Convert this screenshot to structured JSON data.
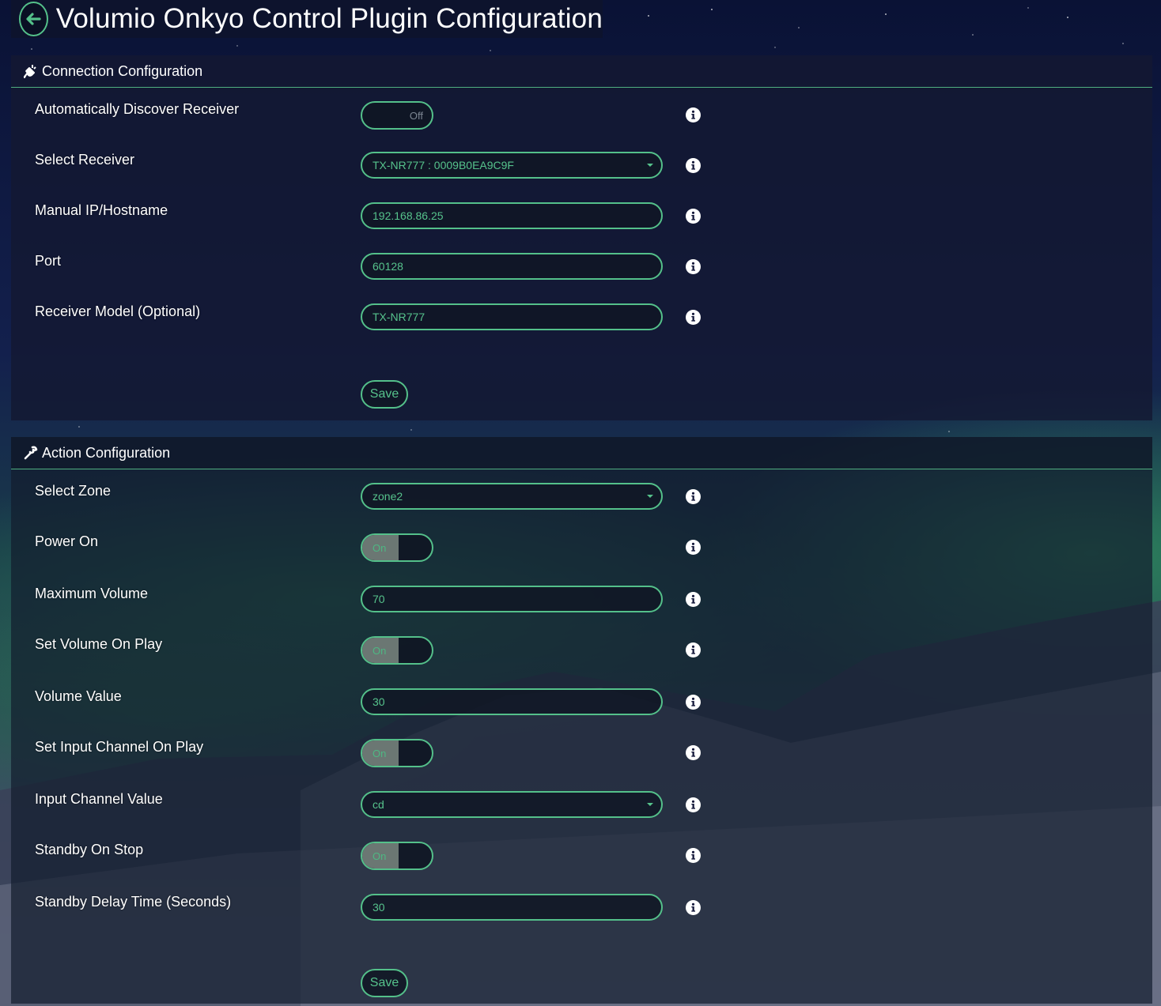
{
  "header": {
    "title": "Volumio Onkyo Control Plugin Configuration",
    "back_icon": "arrow-left-icon"
  },
  "theme": {
    "accent": "#54c08a",
    "panel_bg": "#14183a"
  },
  "connection": {
    "heading": "Connection Configuration",
    "heading_icon": "plug-icon",
    "rows": {
      "auto_discover": {
        "label": "Automatically Discover Receiver",
        "on": "",
        "off": "Off",
        "state": "off"
      },
      "select_receiver": {
        "label": "Select Receiver",
        "value": "TX-NR777 : 0009B0EA9C9F"
      },
      "manual_ip": {
        "label": "Manual IP/Hostname",
        "value": "192.168.86.25"
      },
      "port": {
        "label": "Port",
        "value": "60128"
      },
      "model": {
        "label": "Receiver Model (Optional)",
        "value": "TX-NR777"
      }
    },
    "save_label": "Save"
  },
  "action": {
    "heading": "Action Configuration",
    "heading_icon": "wrench-icon",
    "rows": {
      "select_zone": {
        "label": "Select Zone",
        "value": "zone2"
      },
      "power_on": {
        "label": "Power On",
        "on": "On",
        "state": "on"
      },
      "max_volume": {
        "label": "Maximum Volume",
        "value": "70"
      },
      "set_volume": {
        "label": "Set Volume On Play",
        "on": "On",
        "state": "on"
      },
      "volume_value": {
        "label": "Volume Value",
        "value": "30"
      },
      "set_input": {
        "label": "Set Input Channel On Play",
        "on": "On",
        "state": "on"
      },
      "input_value": {
        "label": "Input Channel Value",
        "value": "cd"
      },
      "standby_stop": {
        "label": "Standby On Stop",
        "on": "On",
        "state": "on"
      },
      "standby_delay": {
        "label": "Standby Delay Time (Seconds)",
        "value": "30"
      }
    },
    "save_label": "Save"
  }
}
